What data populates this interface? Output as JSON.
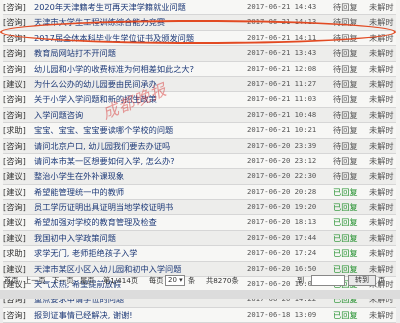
{
  "rows": [
    {
      "type": "[咨询]",
      "title": "2020年天津籍考生可再天津学籍就业问题",
      "date": "2017-06-21 14:43",
      "status": "待回复",
      "state": "未解时"
    },
    {
      "type": "[咨询]",
      "title": "天津市大学生工程训练综合能力竞赛",
      "date": "2017-06-21 14:13",
      "status": "待回复",
      "state": "未解时"
    },
    {
      "type": "[咨询]",
      "title": "2017届全体本科毕业生学位证书及颁发问题",
      "date": "2017-06-21 14:11",
      "status": "待回复",
      "state": "未解时"
    },
    {
      "type": "[咨询]",
      "title": "教育局网站打不开问题",
      "date": "2017-06-21 13:43",
      "status": "待回复",
      "state": "未解时"
    },
    {
      "type": "[咨询]",
      "title": "幼儿园和小学的收费标准为何相差如此之大?",
      "date": "2017-06-21 12:08",
      "status": "待回复",
      "state": "未解时"
    },
    {
      "type": "[建议]",
      "title": "为什么公办的幼儿园要由民间承办",
      "date": "2017-06-21 11:27",
      "status": "待回复",
      "state": "未解时"
    },
    {
      "type": "[咨询]",
      "title": "关于小学入学问题和新的招生政策",
      "date": "2017-06-21 11:03",
      "status": "待回复",
      "state": "未解时"
    },
    {
      "type": "[咨询]",
      "title": "入学问题咨询",
      "date": "2017-06-21 10:48",
      "status": "待回复",
      "state": "未解时"
    },
    {
      "type": "[求助]",
      "title": "宝宝、宝宝、宝宝要读哪个学校的问题",
      "date": "2017-06-21 10:21",
      "status": "待回复",
      "state": "未解时"
    },
    {
      "type": "[咨询]",
      "title": "请问北京户口, 幼儿园我们要去办证吗",
      "date": "2017-06-20 23:39",
      "status": "待回复",
      "state": "未解时"
    },
    {
      "type": "[咨询]",
      "title": "请问本市某一区想要如何入学, 怎么办?",
      "date": "2017-06-20 23:12",
      "status": "待回复",
      "state": "未解时"
    },
    {
      "type": "[建议]",
      "title": "整治小学生在外补课现象",
      "date": "2017-06-20 22:30",
      "status": "待回复",
      "state": "未解时"
    },
    {
      "type": "[建议]",
      "title": "希望能管理统一中的教师",
      "date": "2017-06-20 20:28",
      "status": "已回复",
      "state": "未解时"
    },
    {
      "type": "[咨询]",
      "title": "员工学历证明出具证明当地学校证明书",
      "date": "2017-06-20 19:20",
      "status": "已回复",
      "state": "未解时"
    },
    {
      "type": "[建议]",
      "title": "希望加强对学校的教育管理及检查",
      "date": "2017-06-20 18:13",
      "status": "已回复",
      "state": "未解时"
    },
    {
      "type": "[建议]",
      "title": "我国初中入学政策问题",
      "date": "2017-06-20 17:44",
      "status": "已回复",
      "state": "未解时"
    },
    {
      "type": "[求助]",
      "title": "求学无门, 老师拒绝孩子入学",
      "date": "2017-06-20 17:24",
      "status": "已回复",
      "state": "未解时"
    },
    {
      "type": "[建议]",
      "title": "天津市某区小区入幼儿园和初中入学问题",
      "date": "2017-06-20 16:50",
      "status": "已回复",
      "state": "未解时"
    },
    {
      "type": "[建议]",
      "title": "天气太热, 希望提前放假",
      "date": "2017-06-20 16:04",
      "status": "已回复",
      "state": "未解时"
    },
    {
      "type": "[咨询]",
      "title": "重点要求申请学位的问题",
      "date": "2017-06-20 14:22",
      "status": "已回复",
      "state": "未解时"
    },
    {
      "type": "[咨询]",
      "title": "报到证事情已经解决, 谢谢!",
      "date": "2017-06-18 13:09",
      "status": "已回复",
      "state": "未解时"
    }
  ],
  "pager": {
    "first": "首页",
    "prev": "上一页",
    "next": "下一页",
    "last": "尾页",
    "page_info": "第1/414页",
    "per_page_label": "每页",
    "per_page_value": "20",
    "per_page_unit": "条",
    "total": "共8270条",
    "goto_label": "到",
    "goto_unit": "页",
    "goto_button": "转到"
  },
  "watermark": "成都晚报",
  "colors": {
    "highlight": "#e24a22",
    "replied": "#1f8f2a",
    "title_link": "#1e3a78"
  }
}
